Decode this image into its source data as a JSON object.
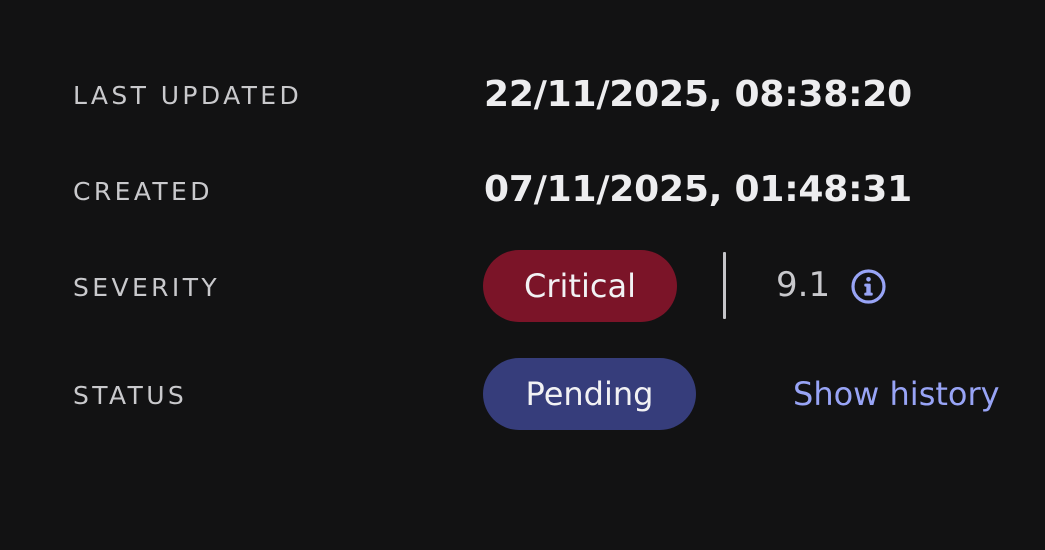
{
  "details": {
    "last_updated": {
      "label": "LAST UPDATED",
      "value": "22/11/2025, 08:38:20"
    },
    "created": {
      "label": "CREATED",
      "value": "07/11/2025, 01:48:31"
    },
    "severity": {
      "label": "SEVERITY",
      "badge": "Critical",
      "badge_color": "#7b1428",
      "score": "9.1",
      "score_info_icon": "info-icon"
    },
    "status": {
      "label": "STATUS",
      "badge": "Pending",
      "badge_color": "#363d7b",
      "history_link": "Show history",
      "link_color": "#98a4f6"
    }
  }
}
